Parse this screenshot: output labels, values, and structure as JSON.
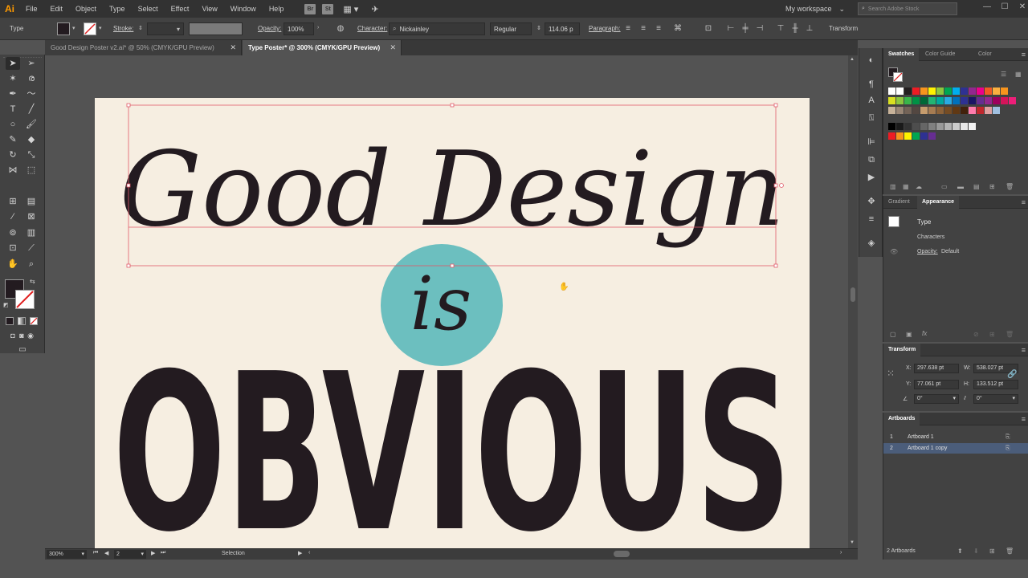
{
  "app": {
    "logo": "Ai"
  },
  "menu": [
    "File",
    "Edit",
    "Object",
    "Type",
    "Select",
    "Effect",
    "View",
    "Window",
    "Help"
  ],
  "bridge_buttons": [
    "Br",
    "St"
  ],
  "workspace": {
    "label": "My workspace"
  },
  "search": {
    "placeholder": "Search Adobe Stock"
  },
  "window_controls": [
    "—",
    "☐",
    "✕"
  ],
  "control_bar": {
    "type_label": "Type",
    "stroke_label": "Stroke:",
    "opacity_label": "Opacity:",
    "opacity_value": "100%",
    "character_label": "Character:",
    "font_name": "Nickainley",
    "font_style": "Regular",
    "font_size": "114.06 p",
    "paragraph_label": "Paragraph:",
    "transform_label": "Transform"
  },
  "tabs": [
    {
      "label": "Good Design Poster v2.ai* @ 50% (CMYK/GPU Preview)",
      "active": false
    },
    {
      "label": "Type Poster* @ 300% (CMYK/GPU Preview)",
      "active": true
    }
  ],
  "artwork": {
    "line1": "Good Design",
    "line2": "is",
    "line3": "OBVIOUS",
    "colors": {
      "background": "#f6eee1",
      "ink": "#231b20",
      "circle": "#6cbfbf"
    }
  },
  "status": {
    "zoom": "300%",
    "artboard_nav": "2",
    "mode": "Selection"
  },
  "swatches_panel": {
    "tabs": [
      "Swatches",
      "Color Guide",
      "Color"
    ],
    "rows": [
      [
        "#ffffff",
        "#ffffff",
        "#231f20",
        "#ed1c24",
        "#f7941d",
        "#fff200",
        "#8dc63f",
        "#00a651",
        "#00aeef",
        "#2e3192",
        "#92278f",
        "#ec008c",
        "#f15a24",
        "#fbb040",
        "#f7941d"
      ],
      [
        "#d9e021",
        "#8cc63f",
        "#39b54a",
        "#009245",
        "#006837",
        "#22b573",
        "#00a99d",
        "#29abe2",
        "#0071bc",
        "#2e3192",
        "#1b1464",
        "#662d91",
        "#93278f",
        "#9e005d",
        "#d4145a",
        "#ed1e79"
      ],
      [
        "#c7b299",
        "#998675",
        "#736357",
        "#534741",
        "#c69c6d",
        "#a67c52",
        "#8c6239",
        "#754c24",
        "#603813",
        "#42210b",
        "#ff7bac",
        "#c1272d",
        "#e0a0a0",
        "#a0c0e0"
      ],
      [
        "#000000",
        "#1a1a1a",
        "#333333",
        "#4d4d4d",
        "#666666",
        "#808080",
        "#999999",
        "#b3b3b3",
        "#cccccc",
        "#e6e6e6",
        "#f2f2f2"
      ],
      [
        "#ed1c24",
        "#f7941d",
        "#fff200",
        "#00a651",
        "#2e3192",
        "#662d91"
      ]
    ]
  },
  "appearance_panel": {
    "tabs": [
      "Gradient",
      "Appearance"
    ],
    "object_type": "Type",
    "characters": "Characters",
    "opacity_label": "Opacity:",
    "opacity_value": "Default"
  },
  "transform_panel": {
    "title": "Transform",
    "x_label": "X:",
    "x_value": "297.638 pt",
    "y_label": "Y:",
    "y_value": "77.061 pt",
    "w_label": "W:",
    "w_value": "538.027 pt",
    "h_label": "H:",
    "h_value": "133.512 pt",
    "rotate_value": "0°",
    "shear_value": "0°"
  },
  "artboards_panel": {
    "title": "Artboards",
    "items": [
      {
        "num": "1",
        "name": "Artboard 1"
      },
      {
        "num": "2",
        "name": "Artboard 1 copy"
      }
    ],
    "footer": "2 Artboards"
  }
}
